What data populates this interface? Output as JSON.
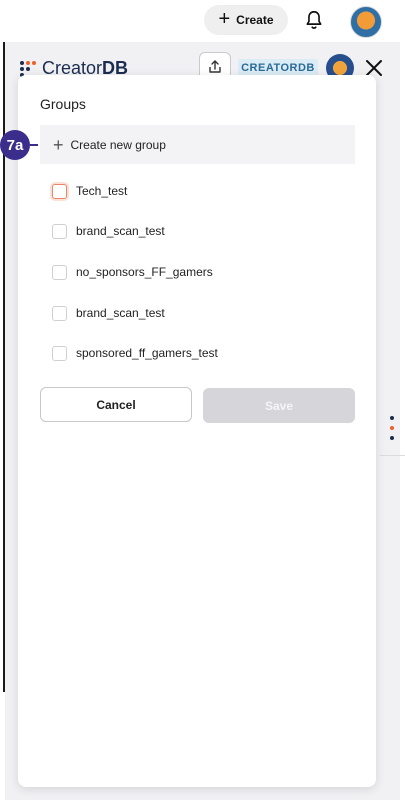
{
  "topbar": {
    "create_label": "Create",
    "create_icon": "plus-icon",
    "bell_icon": "bell-icon",
    "avatar_icon": "user-avatar"
  },
  "panel": {
    "logo_prefix": "Creator",
    "logo_suffix": "DB",
    "share_icon": "share-icon",
    "brand_badge": "CREATORDB",
    "close_icon": "close-icon"
  },
  "modal": {
    "title": "Groups",
    "create_group_label": "Create new group",
    "groups": [
      {
        "label": "Tech_test",
        "checked": false,
        "focused": true
      },
      {
        "label": "brand_scan_test",
        "checked": false,
        "focused": false
      },
      {
        "label": "no_sponsors_FF_gamers",
        "checked": false,
        "focused": false
      },
      {
        "label": "brand_scan_test",
        "checked": false,
        "focused": false
      },
      {
        "label": "sponsored_ff_gamers_test",
        "checked": false,
        "focused": false
      }
    ],
    "cancel_label": "Cancel",
    "save_label": "Save",
    "save_enabled": false
  },
  "annotation": {
    "label": "7a"
  },
  "colors": {
    "accent": "#3b2d8c",
    "checkbox_focus": "#e8866c",
    "brand_badge_bg": "#dcecf6",
    "brand_badge_text": "#2a6b96",
    "logo_dot_orange": "#f0602a",
    "logo_dot_navy": "#1b2d4f"
  }
}
